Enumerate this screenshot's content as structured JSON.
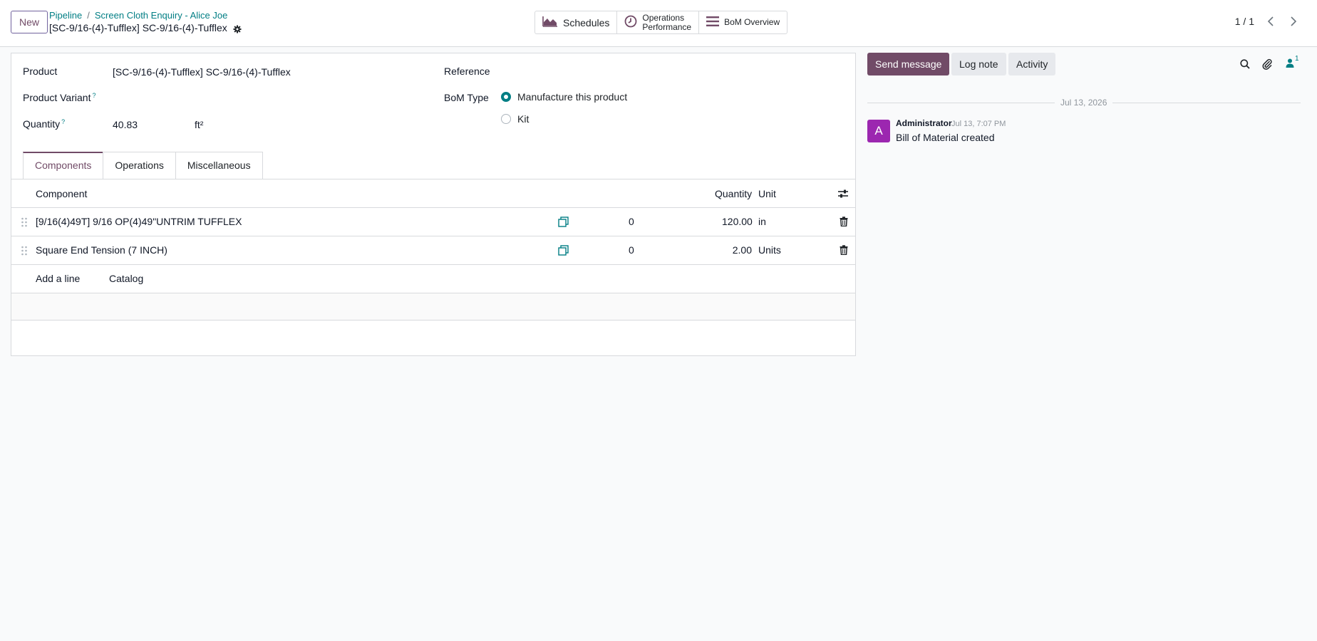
{
  "control_panel": {
    "new_button": "New",
    "breadcrumb": [
      "Pipeline",
      "Screen Cloth Enquiry - Alice Joe"
    ],
    "breadcrumb_sep": "/",
    "record_title": "[SC-9/16-(4)-Tufflex] SC-9/16-(4)-Tufflex",
    "smart_buttons": {
      "schedules": "Schedules",
      "operations_line1": "Operations",
      "operations_line2": "Performance",
      "bom_overview": "BoM Overview"
    },
    "pager": "1 / 1"
  },
  "form": {
    "product_label": "Product",
    "product_value": "[SC-9/16-(4)-Tufflex] SC-9/16-(4)-Tufflex",
    "variant_label": "Product Variant",
    "help_mark": "?",
    "quantity_label": "Quantity",
    "quantity_value": "40.83",
    "quantity_uom": "ft²",
    "reference_label": "Reference",
    "bom_type_label": "BoM Type",
    "bom_type_options": [
      "Manufacture this product",
      "Kit"
    ],
    "bom_type_selected": "Manufacture this product"
  },
  "tabs": [
    "Components",
    "Operations",
    "Miscellaneous"
  ],
  "components_table": {
    "headers": {
      "component": "Component",
      "quantity": "Quantity",
      "unit": "Unit"
    },
    "rows": [
      {
        "component": "[9/16(4)49T] 9/16 OP(4)49\"UNTRIM TUFFLEX",
        "count": "0",
        "quantity": "120.00",
        "unit": "in"
      },
      {
        "component": "Square End Tension (7 INCH)",
        "count": "0",
        "quantity": "2.00",
        "unit": "Units"
      }
    ],
    "add_line": "Add a line",
    "catalog": "Catalog"
  },
  "chatter": {
    "send_message": "Send message",
    "log_note": "Log note",
    "activity": "Activity",
    "followers_count": "1",
    "date_separator": "Jul 13, 2026",
    "message": {
      "avatar_letter": "A",
      "author": "Administrator",
      "timestamp": "Jul 13, 7:07 PM",
      "body": "Bill of Material created"
    }
  },
  "colors": {
    "brand": "#714b67",
    "link": "#017e84",
    "avatar": "#9c27b0"
  },
  "icons": [
    "gear-icon",
    "area-chart-icon",
    "clock-icon",
    "list-icon",
    "chevron-left-icon",
    "chevron-right-icon",
    "drag-handle-icon",
    "copy-icon",
    "trash-icon",
    "settings-sliders-icon",
    "search-icon",
    "paperclip-icon",
    "user-icon"
  ]
}
